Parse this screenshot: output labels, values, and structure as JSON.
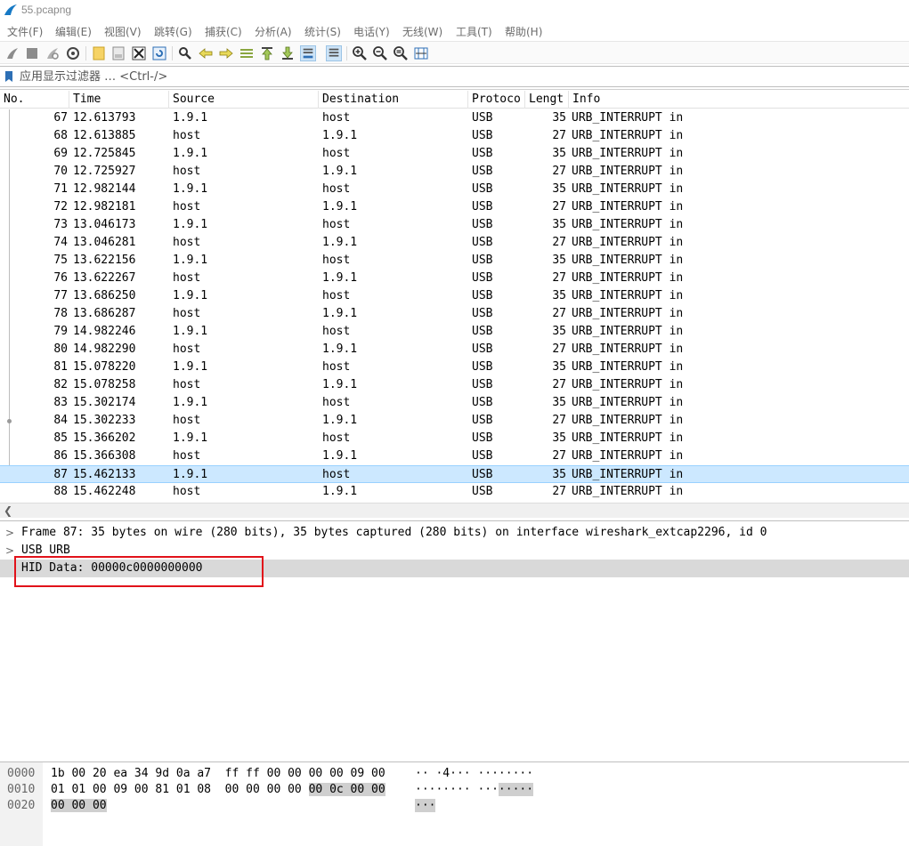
{
  "window": {
    "title": "55.pcapng"
  },
  "menu": [
    "文件(F)",
    "编辑(E)",
    "视图(V)",
    "跳转(G)",
    "捕获(C)",
    "分析(A)",
    "统计(S)",
    "电话(Y)",
    "无线(W)",
    "工具(T)",
    "帮助(H)"
  ],
  "toolbar": {
    "icons": [
      "start-capture-icon",
      "stop-capture-icon",
      "restart-capture-icon",
      "capture-options-icon",
      "open-file-icon",
      "save-file-icon",
      "close-file-icon",
      "reload-file-icon",
      "find-packet-icon",
      "go-back-icon",
      "go-forward-icon",
      "go-to-packet-icon",
      "go-first-icon",
      "go-last-icon",
      "autoscroll-icon",
      "colorize-icon",
      "zoom-in-icon",
      "zoom-out-icon",
      "normal-size-icon",
      "resize-columns-icon"
    ]
  },
  "filter": {
    "placeholder": "应用显示过滤器 … <Ctrl-/>"
  },
  "packet_list": {
    "columns": [
      "No.",
      "Time",
      "Source",
      "Destination",
      "Protoco",
      "Lengt",
      "Info"
    ],
    "rows": [
      {
        "no": "67",
        "time": "12.613793",
        "src": "1.9.1",
        "dst": "host",
        "proto": "USB",
        "len": "35",
        "info": "URB_INTERRUPT in"
      },
      {
        "no": "68",
        "time": "12.613885",
        "src": "host",
        "dst": "1.9.1",
        "proto": "USB",
        "len": "27",
        "info": "URB_INTERRUPT in"
      },
      {
        "no": "69",
        "time": "12.725845",
        "src": "1.9.1",
        "dst": "host",
        "proto": "USB",
        "len": "35",
        "info": "URB_INTERRUPT in"
      },
      {
        "no": "70",
        "time": "12.725927",
        "src": "host",
        "dst": "1.9.1",
        "proto": "USB",
        "len": "27",
        "info": "URB_INTERRUPT in"
      },
      {
        "no": "71",
        "time": "12.982144",
        "src": "1.9.1",
        "dst": "host",
        "proto": "USB",
        "len": "35",
        "info": "URB_INTERRUPT in"
      },
      {
        "no": "72",
        "time": "12.982181",
        "src": "host",
        "dst": "1.9.1",
        "proto": "USB",
        "len": "27",
        "info": "URB_INTERRUPT in"
      },
      {
        "no": "73",
        "time": "13.046173",
        "src": "1.9.1",
        "dst": "host",
        "proto": "USB",
        "len": "35",
        "info": "URB_INTERRUPT in"
      },
      {
        "no": "74",
        "time": "13.046281",
        "src": "host",
        "dst": "1.9.1",
        "proto": "USB",
        "len": "27",
        "info": "URB_INTERRUPT in"
      },
      {
        "no": "75",
        "time": "13.622156",
        "src": "1.9.1",
        "dst": "host",
        "proto": "USB",
        "len": "35",
        "info": "URB_INTERRUPT in"
      },
      {
        "no": "76",
        "time": "13.622267",
        "src": "host",
        "dst": "1.9.1",
        "proto": "USB",
        "len": "27",
        "info": "URB_INTERRUPT in"
      },
      {
        "no": "77",
        "time": "13.686250",
        "src": "1.9.1",
        "dst": "host",
        "proto": "USB",
        "len": "35",
        "info": "URB_INTERRUPT in"
      },
      {
        "no": "78",
        "time": "13.686287",
        "src": "host",
        "dst": "1.9.1",
        "proto": "USB",
        "len": "27",
        "info": "URB_INTERRUPT in"
      },
      {
        "no": "79",
        "time": "14.982246",
        "src": "1.9.1",
        "dst": "host",
        "proto": "USB",
        "len": "35",
        "info": "URB_INTERRUPT in"
      },
      {
        "no": "80",
        "time": "14.982290",
        "src": "host",
        "dst": "1.9.1",
        "proto": "USB",
        "len": "27",
        "info": "URB_INTERRUPT in"
      },
      {
        "no": "81",
        "time": "15.078220",
        "src": "1.9.1",
        "dst": "host",
        "proto": "USB",
        "len": "35",
        "info": "URB_INTERRUPT in"
      },
      {
        "no": "82",
        "time": "15.078258",
        "src": "host",
        "dst": "1.9.1",
        "proto": "USB",
        "len": "27",
        "info": "URB_INTERRUPT in"
      },
      {
        "no": "83",
        "time": "15.302174",
        "src": "1.9.1",
        "dst": "host",
        "proto": "USB",
        "len": "35",
        "info": "URB_INTERRUPT in"
      },
      {
        "no": "84",
        "time": "15.302233",
        "src": "host",
        "dst": "1.9.1",
        "proto": "USB",
        "len": "27",
        "info": "URB_INTERRUPT in"
      },
      {
        "no": "85",
        "time": "15.366202",
        "src": "1.9.1",
        "dst": "host",
        "proto": "USB",
        "len": "35",
        "info": "URB_INTERRUPT in"
      },
      {
        "no": "86",
        "time": "15.366308",
        "src": "host",
        "dst": "1.9.1",
        "proto": "USB",
        "len": "27",
        "info": "URB_INTERRUPT in"
      },
      {
        "no": "87",
        "time": "15.462133",
        "src": "1.9.1",
        "dst": "host",
        "proto": "USB",
        "len": "35",
        "info": "URB_INTERRUPT in"
      },
      {
        "no": "88",
        "time": "15.462248",
        "src": "host",
        "dst": "1.9.1",
        "proto": "USB",
        "len": "27",
        "info": "URB_INTERRUPT in"
      }
    ]
  },
  "details": {
    "frame": "Frame 87: 35 bytes on wire (280 bits), 35 bytes captured (280 bits) on interface wireshark_extcap2296, id 0",
    "usb": "USB URB",
    "hid": "HID Data: 00000c0000000000"
  },
  "bytes": {
    "rows": [
      {
        "offset": "0000",
        "hex_pre": "1b 00 20 ea 34 9d 0a a7  ff ff 00 00 00 00 09 00",
        "hex_hl": "",
        "ascii_pre": "·· ·4··· ········",
        "ascii_hl": ""
      },
      {
        "offset": "0010",
        "hex_pre": "01 01 00 09 00 81 01 08  00 00 00 00 ",
        "hex_hl": "00 0c 00 00",
        "ascii_pre": "········ ···",
        "ascii_hl": "·····"
      },
      {
        "offset": "0020",
        "hex_pre": "",
        "hex_hl": "00 00 00",
        "ascii_pre": "",
        "ascii_hl": "···"
      }
    ]
  },
  "colors": {
    "selected_row": "#cce8ff",
    "selected_detail": "#d9d9d9",
    "highlight_box": "#e1121a"
  }
}
